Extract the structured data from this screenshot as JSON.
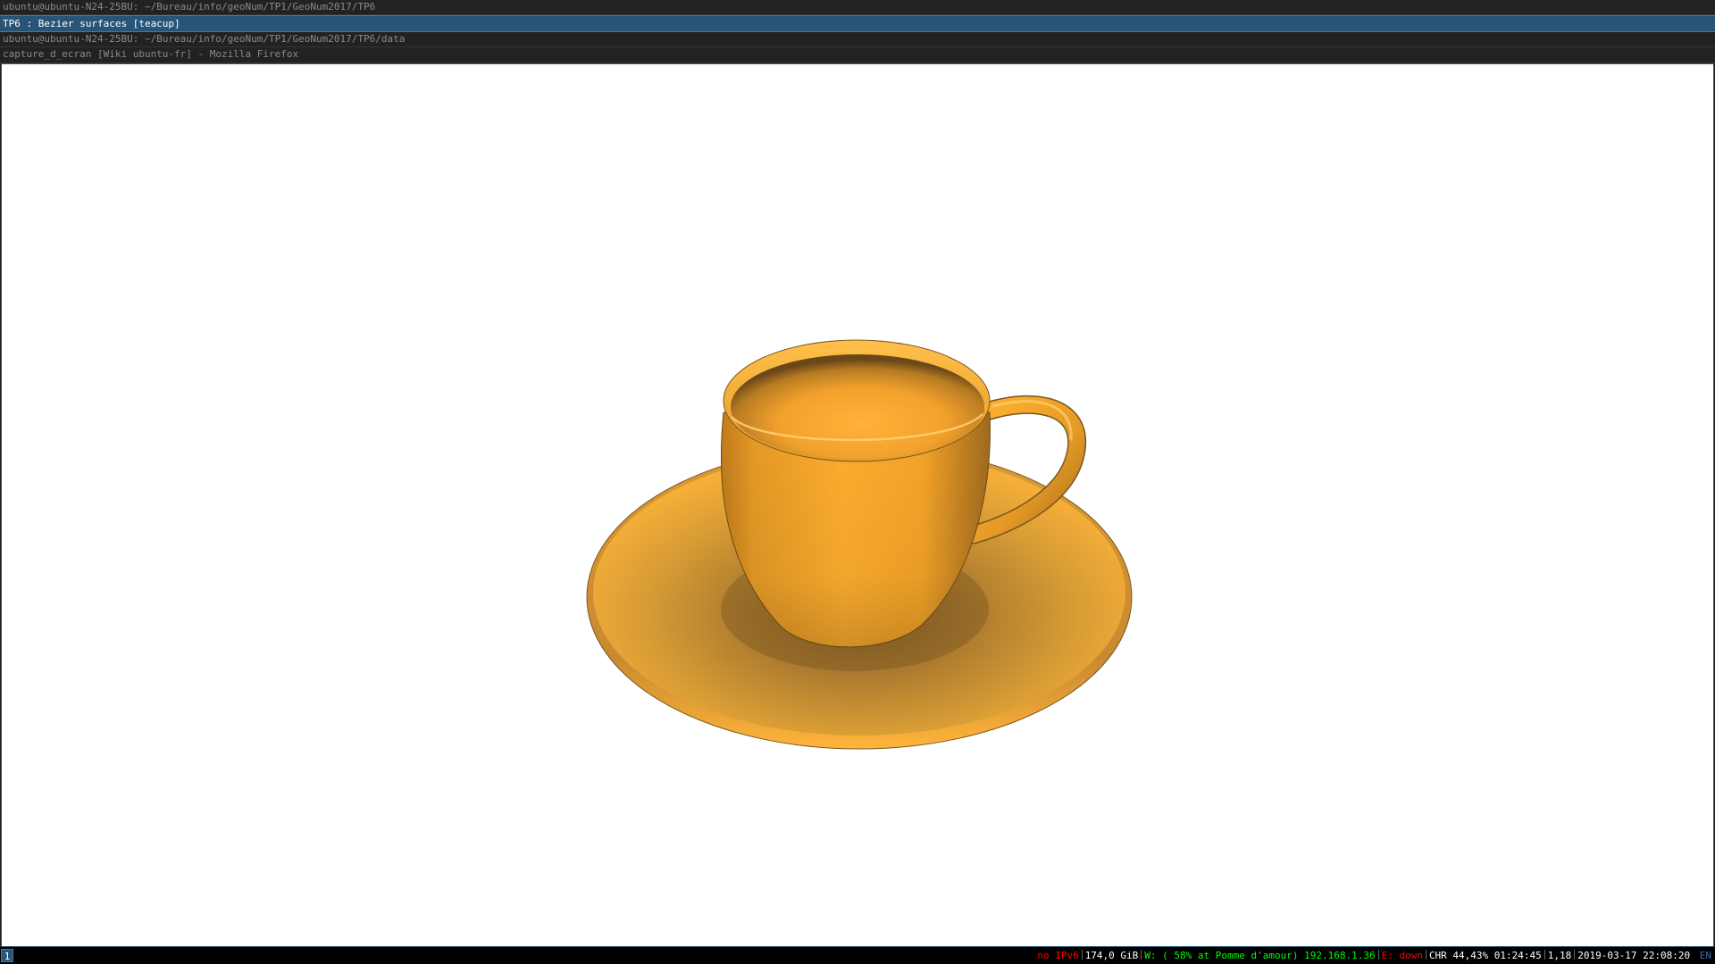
{
  "windows": {
    "terminal1_title": "ubuntu@ubuntu-N24-25BU: ~/Bureau/info/geoNum/TP1/GeoNum2017/TP6",
    "active_title": "TP6 : Bezier surfaces [teacup]",
    "terminal2_title": "ubuntu@ubuntu-N24-25BU: ~/Bureau/info/geoNum/TP1/GeoNum2017/TP6/data",
    "firefox_title": "capture_d_ecran [Wiki ubuntu-fr] - Mozilla Firefox"
  },
  "viewer": {
    "object_color": "#f6a623",
    "background": "#ffffff"
  },
  "statusbar": {
    "workspace": "1",
    "ipv6": "no IPv6",
    "disk": "174,0 GiB",
    "wireless": "W: ( 58% at Pomme d'amour) 192.168.1.36",
    "ethernet": "E: down",
    "battery": "CHR 44,43% 01:24:45",
    "load": "1,18",
    "datetime": "2019-03-17 22:08:20",
    "lang": "EN",
    "colors": {
      "ipv6": "#ff0000",
      "wireless": "#00ff00",
      "ethernet": "#ff0000",
      "lang": "#285577"
    }
  }
}
